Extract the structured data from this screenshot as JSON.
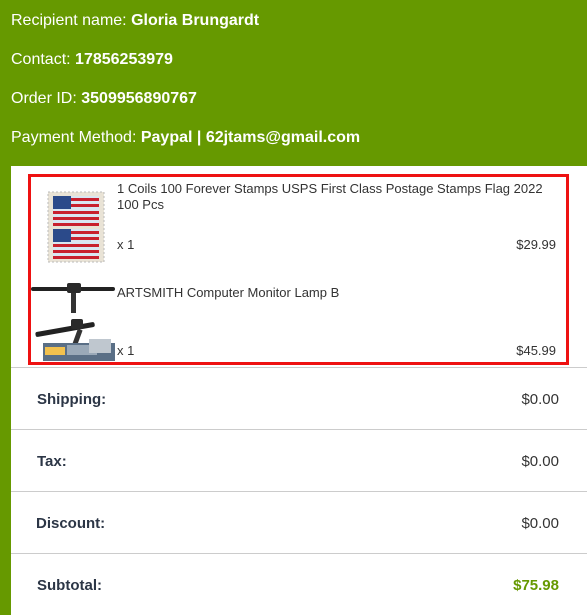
{
  "recipient": {
    "label": "Recipient name:",
    "value": "Gloria Brungardt"
  },
  "contact": {
    "label": "Contact:",
    "value": "17856253979"
  },
  "order": {
    "label": "Order ID:",
    "value": "3509956890767"
  },
  "payment": {
    "label": "Payment Method:",
    "value": "Paypal | 62jtams@gmail.com"
  },
  "products": [
    {
      "name": "1 Coils 100 Forever Stamps USPS First Class Postage Stamps Flag 2022 100 Pcs",
      "qty": "x 1",
      "price": "$29.99",
      "thumb_icon": "flag-stamps-thumbnail"
    },
    {
      "name": "ARTSMITH Computer Monitor Lamp B",
      "qty": "x 1",
      "price": "$45.99",
      "thumb_icon": "monitor-lamp-thumbnail"
    }
  ],
  "summary": {
    "shipping": {
      "label": "Shipping:",
      "value": "$0.00"
    },
    "tax": {
      "label": "Tax:",
      "value": "$0.00"
    },
    "discount": {
      "label": "Discount:",
      "value": "$0.00"
    },
    "subtotal": {
      "label": "Subtotal:",
      "value": "$75.98"
    }
  },
  "colors": {
    "background": "#669900",
    "highlight_border": "#ee1111",
    "subtotal_value": "#669900"
  }
}
